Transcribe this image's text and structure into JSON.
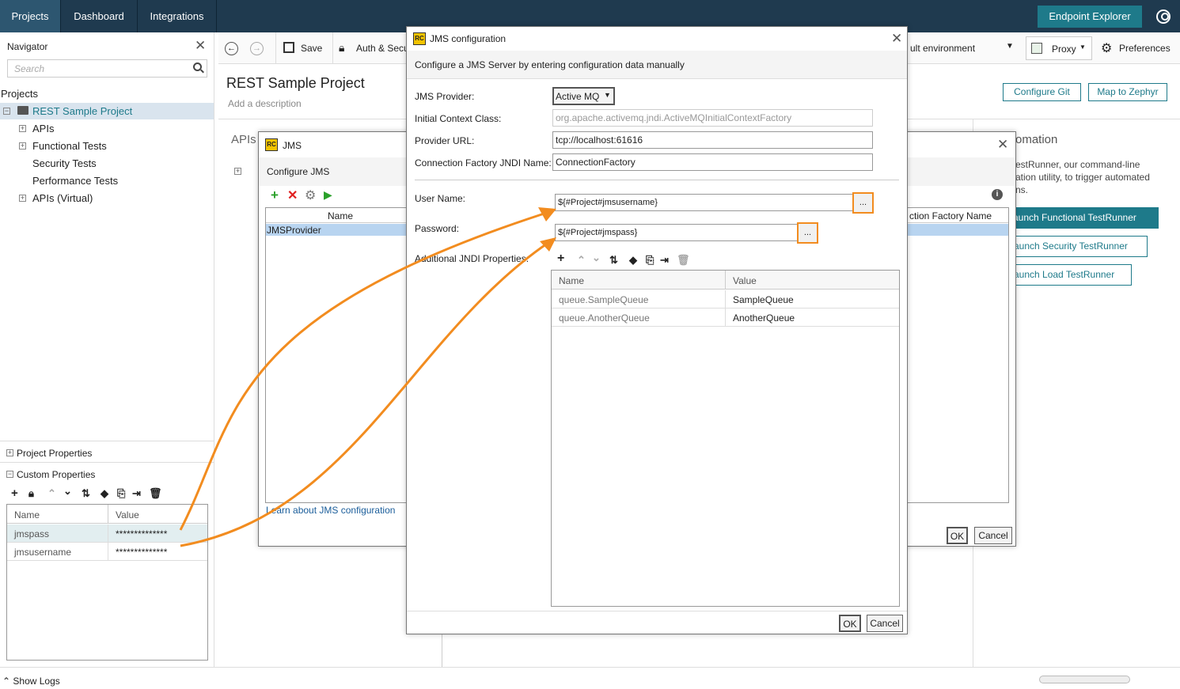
{
  "topbar": {
    "tabs": [
      "Projects",
      "Dashboard",
      "Integrations"
    ],
    "endpoint_explorer": "Endpoint Explorer"
  },
  "navigator": {
    "title": "Navigator",
    "search_placeholder": "Search",
    "projects_label": "Projects",
    "project_name": "REST Sample Project",
    "children": [
      "APIs",
      "Functional Tests",
      "Security Tests",
      "Performance Tests",
      "APIs (Virtual)"
    ],
    "project_properties": "Project Properties",
    "custom_properties": "Custom Properties",
    "props_columns": [
      "Name",
      "Value"
    ],
    "props_rows": [
      {
        "name": "jmspass",
        "value": "**************"
      },
      {
        "name": "jmsusername",
        "value": "**************"
      }
    ],
    "show_logs": "Show Logs"
  },
  "toolbar": {
    "save": "Save",
    "auth": "Auth & Secu",
    "environment": "ult environment",
    "proxy": "Proxy",
    "preferences": "Preferences"
  },
  "project_page": {
    "title": "REST Sample Project",
    "description_placeholder": "Add a description",
    "apis_heading": "APIs",
    "configure_git": "Configure Git",
    "map_zephyr": "Map to Zephyr",
    "automation_heading": "omation",
    "automation_text": [
      "estRunner, our command-line",
      "ation utility, to trigger automated",
      "ns."
    ],
    "launch_functional": "aunch Functional TestRunner",
    "launch_security": "aunch Security TestRunner",
    "launch_load": "aunch Load TestRunner"
  },
  "jms_dialog": {
    "title": "JMS",
    "subtitle": "Configure JMS",
    "col_name": "Name",
    "col_cf": "ction Factory Name",
    "row": "JMSProvider",
    "learn_link": "Learn about JMS configuration",
    "ok": "OK",
    "cancel": "Cancel"
  },
  "jms_config": {
    "title": "JMS configuration",
    "description": "Configure a JMS Server by entering configuration data manually",
    "provider_label": "JMS Provider:",
    "provider_value": "Active MQ",
    "context_label": "Initial Context Class:",
    "context_value": "org.apache.activemq.jndi.ActiveMQInitialContextFactory",
    "url_label": "Provider URL:",
    "url_value": "tcp://localhost:61616",
    "cf_label": "Connection Factory JNDI Name:",
    "cf_value": "ConnectionFactory",
    "user_label": "User Name:",
    "user_value": "${#Project#jmsusername}",
    "pass_label": "Password:",
    "pass_value": "${#Project#jmspass}",
    "dots": "...",
    "addl_label": "Additional JNDI Properties:",
    "table_cols": [
      "Name",
      "Value"
    ],
    "table_rows": [
      {
        "name": "queue.SampleQueue",
        "value": "SampleQueue"
      },
      {
        "name": "queue.AnotherQueue",
        "value": "AnotherQueue"
      }
    ],
    "ok": "OK",
    "cancel": "Cancel"
  },
  "colors": {
    "topbar": "#1f3a4f",
    "accent": "#1e7a8a",
    "highlight": "#f28c1f"
  }
}
